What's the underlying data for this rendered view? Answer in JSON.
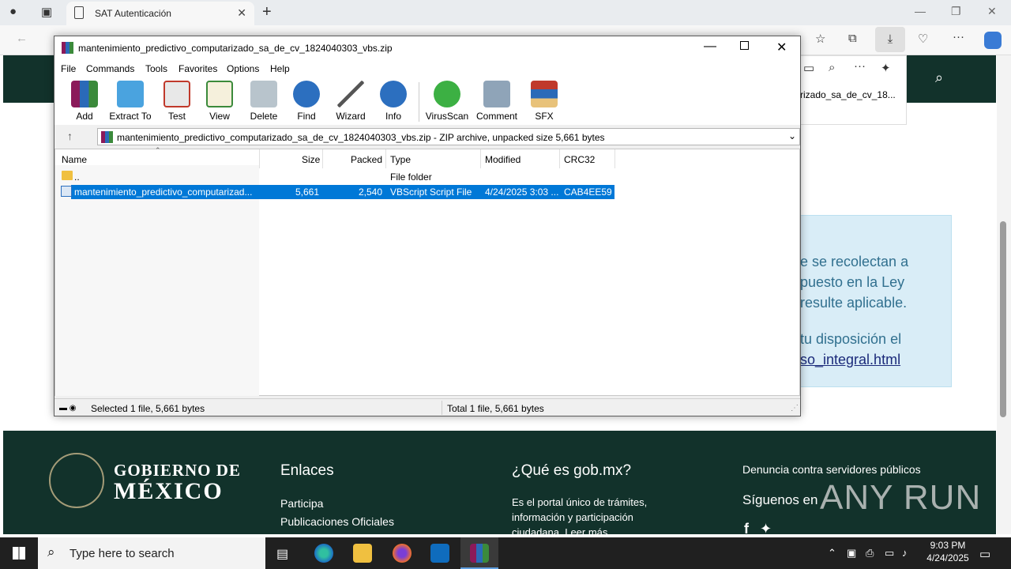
{
  "browser": {
    "tab_title": "SAT Autenticación",
    "download_item": "rizado_sa_de_cv_18..."
  },
  "webpage": {
    "notice_lines": [
      "e se recolectan a",
      "puesto en la Ley",
      "resulte aplicable.",
      "tu disposición el"
    ],
    "notice_link": "so_integral.html",
    "footer": {
      "logo_line1": "GOBIERNO DE",
      "logo_line2": "MÉXICO",
      "links_title": "Enlaces",
      "links": [
        "Participa",
        "Publicaciones Oficiales"
      ],
      "what_title": "¿Qué es gob.mx?",
      "what_text": [
        "Es el portal único de trámites,",
        "información y participación",
        "ciudadana. Leer más"
      ],
      "denuncia": "Denuncia contra servidores públicos",
      "siguenos": "Síguenos en"
    }
  },
  "winrar": {
    "title": "mantenimiento_predictivo_computarizado_sa_de_cv_1824040303_vbs.zip",
    "menu": [
      "File",
      "Commands",
      "Tools",
      "Favorites",
      "Options",
      "Help"
    ],
    "toolbar": [
      "Add",
      "Extract To",
      "Test",
      "View",
      "Delete",
      "Find",
      "Wizard",
      "Info",
      "VirusScan",
      "Comment",
      "SFX"
    ],
    "address": "mantenimiento_predictivo_computarizado_sa_de_cv_1824040303_vbs.zip - ZIP archive, unpacked size 5,661 bytes",
    "columns": [
      "Name",
      "Size",
      "Packed",
      "Type",
      "Modified",
      "CRC32"
    ],
    "rows": [
      {
        "name": "..",
        "size": "",
        "packed": "",
        "type": "File folder",
        "modified": "",
        "crc": ""
      },
      {
        "name": "mantenimiento_predictivo_computarizad...",
        "size": "5,661",
        "packed": "2,540",
        "type": "VBScript Script File",
        "modified": "4/24/2025 3:03 ...",
        "crc": "CAB4EE59"
      }
    ],
    "status_left": "Selected 1 file, 5,661 bytes",
    "status_right": "Total 1 file, 5,661 bytes"
  },
  "taskbar": {
    "search_placeholder": "Type here to search",
    "time": "9:03 PM",
    "date": "4/24/2025"
  },
  "watermark": "ANY RUN",
  "colors": {
    "header_green": "#12322b",
    "selection_blue": "#0078d7",
    "notice_bg": "#d9edf7"
  }
}
